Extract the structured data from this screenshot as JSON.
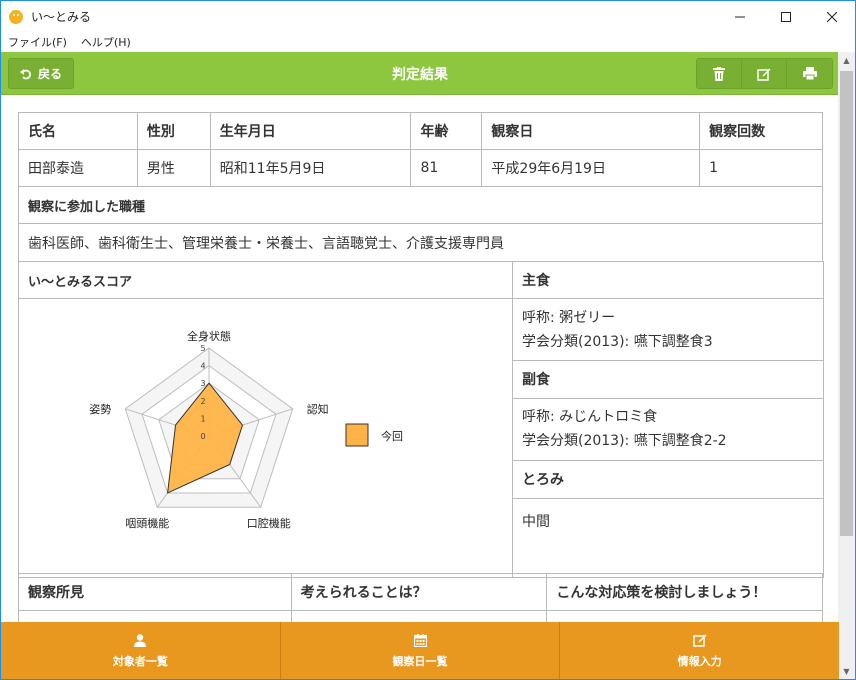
{
  "window": {
    "title": "い〜とみる",
    "icon": "smiley-icon"
  },
  "menu": [
    "ファイル(F)",
    "ヘルプ(H)"
  ],
  "header": {
    "back_label": "戻る",
    "title": "判定結果"
  },
  "info": {
    "headers": [
      "氏名",
      "性別",
      "生年月日",
      "年齢",
      "観察日",
      "観察回数"
    ],
    "values": [
      "田部泰造",
      "男性",
      "昭和11年5月9日",
      "81",
      "平成29年6月19日",
      "1"
    ]
  },
  "occupations": {
    "heading": "観察に参加した職種",
    "value": "歯科医師、歯科衛生士、管理栄養士・栄養士、言語聴覚士、介護支援専門員"
  },
  "score": {
    "heading": "い〜とみるスコア"
  },
  "chart_data": {
    "type": "radar",
    "categories": [
      "全身状態",
      "認知",
      "口腔機能",
      "咽頭機能",
      "姿勢"
    ],
    "ticks": [
      "0",
      "1",
      "2",
      "3",
      "4",
      "5"
    ],
    "range": [
      0,
      5
    ],
    "series": [
      {
        "name": "今回",
        "values": [
          3,
          2,
          2,
          4,
          2
        ],
        "color": "#ffb347"
      }
    ]
  },
  "staple": {
    "heading": "主食",
    "line1": "呼称: 粥ゼリー",
    "line2": "学会分類(2013): 嚥下調整食3"
  },
  "side": {
    "heading": "副食",
    "line1": "呼称: みじんトロミ食",
    "line2": "学会分類(2013): 嚥下調整食2-2"
  },
  "thick": {
    "heading": "とろみ",
    "value": "中間"
  },
  "findings": {
    "col1": "観察所見",
    "col2": "考えられることは？",
    "col3": "こんな対応策を検討しましょう！"
  },
  "bottom_nav": [
    {
      "label": "対象者一覧",
      "icon": "user-icon"
    },
    {
      "label": "観察日一覧",
      "icon": "calendar-icon"
    },
    {
      "label": "情報入力",
      "icon": "edit-icon"
    }
  ]
}
